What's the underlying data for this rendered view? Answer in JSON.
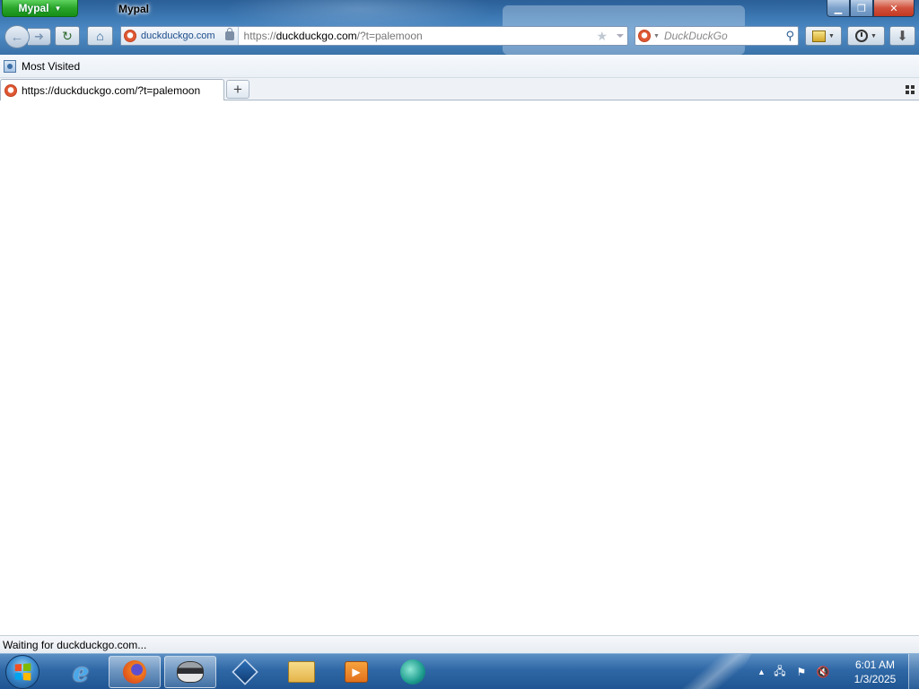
{
  "app": {
    "menu_button_label": "Mypal",
    "window_title": "Mypal"
  },
  "nav": {
    "identity_host": "duckduckgo.com",
    "url_prefix": "https://",
    "url_host": "duckduckgo.com",
    "url_suffix": "/?t=palemoon",
    "search_placeholder": "DuckDuckGo"
  },
  "bookmarks_toolbar": {
    "items": [
      {
        "label": "Most Visited",
        "icon": "page-icon"
      }
    ]
  },
  "tabs": [
    {
      "label": "https://duckduckgo.com/?t=palemoon",
      "icon": "duckduckgo-favicon",
      "active": true
    }
  ],
  "status_bar": {
    "text": "Waiting for duckduckgo.com..."
  },
  "taskbar": {
    "items": [
      {
        "name": "internet-explorer",
        "icon": "ie-icon",
        "active": false
      },
      {
        "name": "firefox",
        "icon": "firefox-icon",
        "active": true
      },
      {
        "name": "mypal",
        "icon": "raccoon-icon",
        "active": true
      },
      {
        "name": "virtualbox",
        "icon": "virtualbox-icon",
        "active": false
      },
      {
        "name": "explorer",
        "icon": "folder-icon",
        "active": false
      },
      {
        "name": "media-player",
        "icon": "media-icon",
        "active": false
      },
      {
        "name": "browser",
        "icon": "globe-icon",
        "active": false
      }
    ],
    "clock": {
      "time": "6:01 AM",
      "date": "1/3/2025"
    }
  },
  "colors": {
    "app_button": "#2aa52a",
    "close_button": "#c23821",
    "taskbar": "#2f68a6",
    "duckduckgo_brand": "#de5833"
  }
}
